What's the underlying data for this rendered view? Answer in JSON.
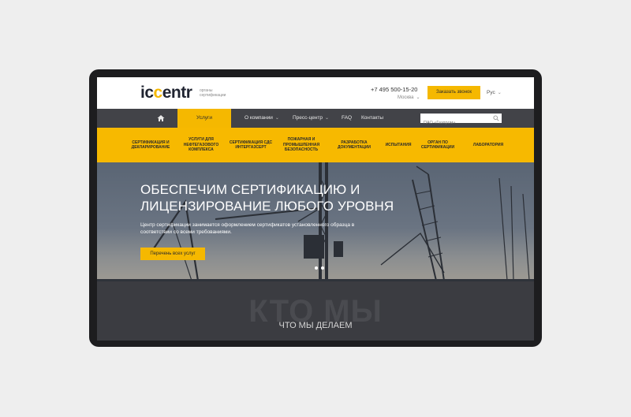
{
  "brand": {
    "logo_prefix": "ic",
    "logo_accent": "c",
    "logo_suffix": "entr",
    "tagline": "органы сертификации"
  },
  "header": {
    "phone": "+7 495 500-15-20",
    "city": "Москва",
    "call_button": "Заказать звонок",
    "lang": "Рус"
  },
  "main_nav": {
    "items": [
      {
        "label": "Услуги",
        "active": true
      },
      {
        "label": "О компании",
        "has_dropdown": true
      },
      {
        "label": "Пресс-центр",
        "has_dropdown": true
      },
      {
        "label": "FAQ"
      },
      {
        "label": "Контакты"
      }
    ],
    "search_placeholder": "ПАО «Газпром»"
  },
  "sub_nav": {
    "items": [
      "Сертификация и декларирование",
      "Услуги для нефтегазового комплекса",
      "Сертификация СДС Интергазсерт",
      "Пожарная и промышленная безопасность",
      "Разработка документации",
      "Испытания",
      "Орган по сертификации",
      "Лаборатория"
    ]
  },
  "hero": {
    "title": "ОБЕСПЕЧИМ СЕРТИФИКАЦИЮ И ЛИЦЕНЗИРОВАНИЕ ЛЮБОГО УРОВНЯ",
    "text": "Центр сертификации занимается оформлением сертификатов установленного образца в соответствии со всеми требованиями.",
    "button": "Перечень всех услуг",
    "slides_count": 2,
    "active_slide": 1
  },
  "section": {
    "ghost_title": "КТО МЫ",
    "title": "ЧТО МЫ ДЕЛАЕМ"
  },
  "colors": {
    "accent": "#f5b800",
    "nav_bg": "#424348",
    "dark_section": "#3b3c41",
    "device_frame": "#1d1d1f"
  }
}
